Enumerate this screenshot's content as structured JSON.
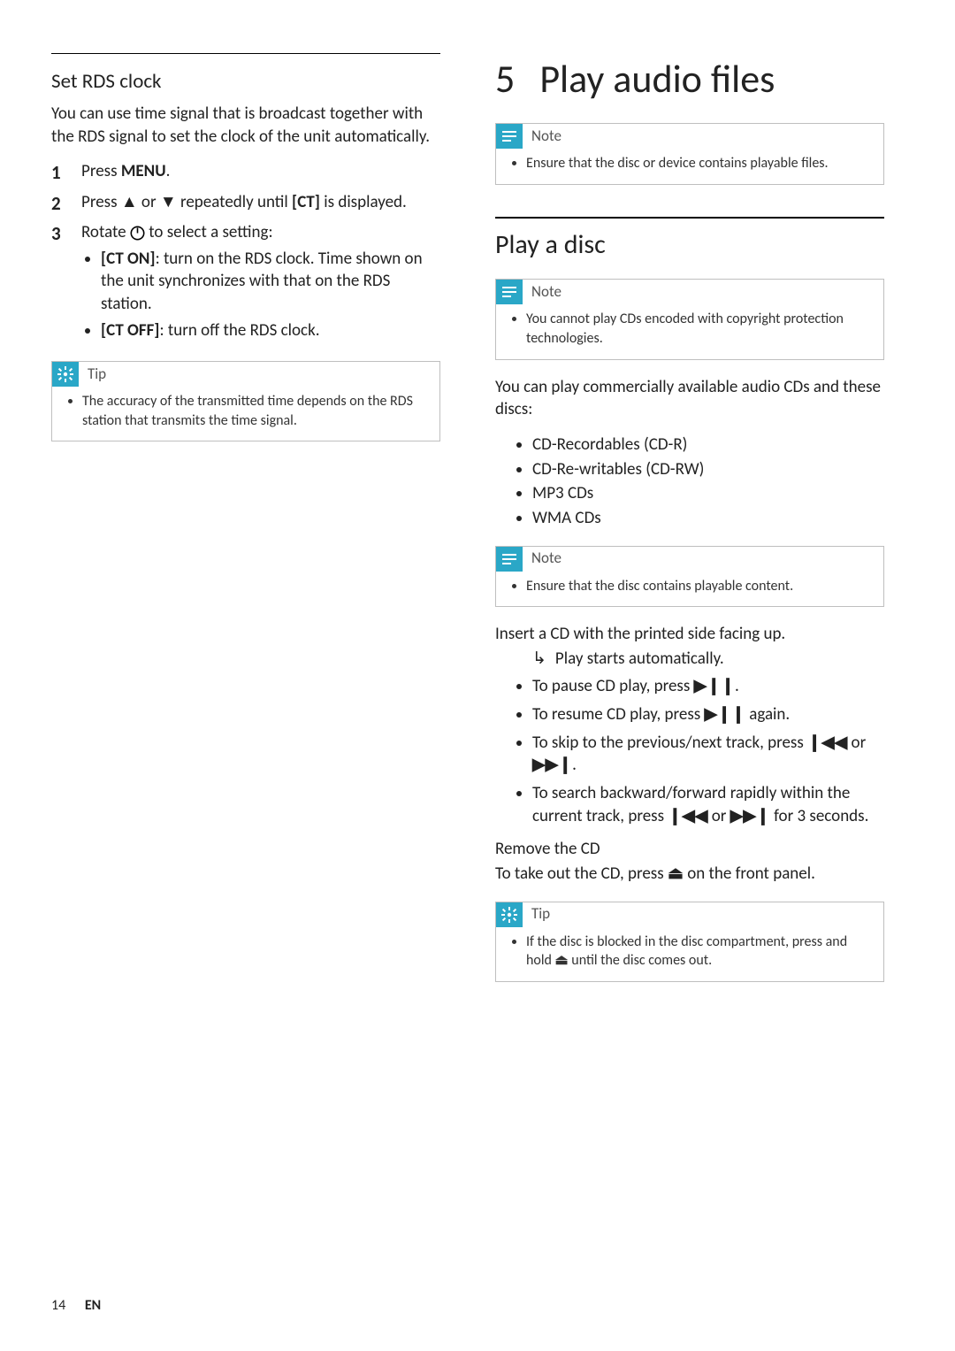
{
  "left": {
    "heading": "Set RDS clock",
    "intro": "You can use time signal that is broadcast together with the RDS signal to set the clock of the unit automatically.",
    "steps": [
      {
        "num": "1",
        "pre": "Press ",
        "bold": "MENU",
        "post": "."
      },
      {
        "num": "2",
        "pre": "Press ",
        "mid1": " or ",
        "mid2": " repeatedly until ",
        "bold": "[CT]",
        "post": " is displayed."
      },
      {
        "num": "3",
        "pre": "Rotate ",
        "post": " to select a setting:",
        "sub": [
          {
            "bold": "[CT ON]",
            "txt": ": turn on the RDS clock. Time shown on the unit synchronizes with that on the RDS station."
          },
          {
            "bold": "[CT OFF]",
            "txt": ": turn off the RDS clock."
          }
        ]
      }
    ],
    "tip": {
      "title": "Tip",
      "items": [
        "The accuracy of the transmitted time depends on the RDS station that transmits the time signal."
      ]
    }
  },
  "right": {
    "chapter_num": "5",
    "chapter_title": "Play audio files",
    "note1": {
      "title": "Note",
      "items": [
        "Ensure that the disc or device contains playable files."
      ]
    },
    "sec1_title": "Play a disc",
    "note2": {
      "title": "Note",
      "items": [
        "You cannot play CDs encoded with copyright protection technologies."
      ]
    },
    "intro2": "You can play commercially available audio CDs and these discs:",
    "discs": [
      "CD-Recordables (CD-R)",
      "CD-Re-writables (CD-RW)",
      "MP3 CDs",
      "WMA CDs"
    ],
    "note3": {
      "title": "Note",
      "items": [
        "Ensure that the disc contains playable content."
      ]
    },
    "insert_line": "Insert a CD with the printed side facing up.",
    "auto_play": "Play starts automatically.",
    "controls": {
      "pause_pre": "To pause CD play, press ",
      "pause_post": ".",
      "resume_pre": "To resume CD play, press ",
      "resume_post": " again.",
      "skip_pre": "To skip to the previous/next track, press ",
      "skip_mid": " or ",
      "skip_post": ".",
      "search_pre": "To search backward/forward rapidly within the current track, press ",
      "search_mid": " or ",
      "search_post": " for 3 seconds."
    },
    "remove_head": "Remove the CD",
    "remove_pre": "To take out the CD, press ",
    "remove_post": " on the front panel.",
    "tip2": {
      "title": "Tip",
      "item_pre": "If the disc is blocked in the disc compartment, press and hold ",
      "item_post": " until the disc comes out."
    }
  },
  "footer": {
    "page": "14",
    "lang": "EN"
  }
}
